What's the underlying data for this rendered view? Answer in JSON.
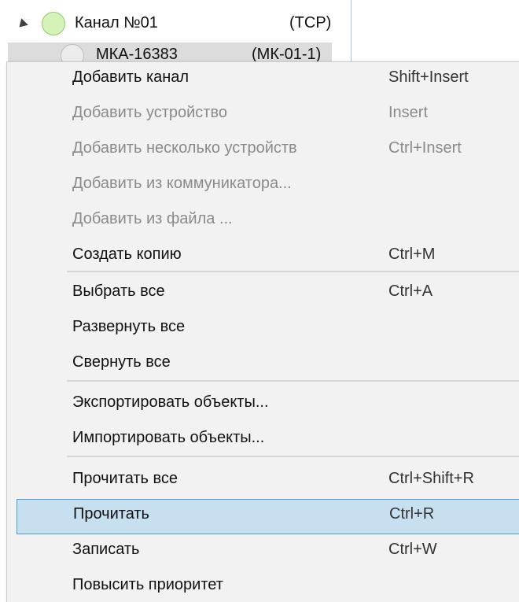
{
  "tree": {
    "channel": {
      "name": "Канал №01",
      "protocol": "(TCP)"
    },
    "device": {
      "name": "МКА-16383",
      "type": "(МК-01-1)"
    }
  },
  "context_menu": {
    "items": [
      {
        "label": "Добавить канал",
        "shortcut": "Shift+Insert",
        "enabled": true
      },
      {
        "label": "Добавить устройство",
        "shortcut": "Insert",
        "enabled": false
      },
      {
        "label": "Добавить несколько устройств",
        "shortcut": "Ctrl+Insert",
        "enabled": false
      },
      {
        "label": "Добавить из коммуникатора...",
        "shortcut": "",
        "enabled": false
      },
      {
        "label": "Добавить из файла ...",
        "shortcut": "",
        "enabled": false
      },
      {
        "label": "Создать копию",
        "shortcut": "Ctrl+M",
        "enabled": true
      },
      {
        "label": "Выбрать все",
        "shortcut": "Ctrl+A",
        "enabled": true
      },
      {
        "label": "Развернуть все",
        "shortcut": "",
        "enabled": true
      },
      {
        "label": "Свернуть все",
        "shortcut": "",
        "enabled": true
      },
      {
        "label": "Экспортировать объекты...",
        "shortcut": "",
        "enabled": true
      },
      {
        "label": "Импортировать объекты...",
        "shortcut": "",
        "enabled": true
      },
      {
        "label": "Прочитать все",
        "shortcut": "Ctrl+Shift+R",
        "enabled": true
      },
      {
        "label": "Прочитать",
        "shortcut": "Ctrl+R",
        "enabled": true,
        "highlighted": true
      },
      {
        "label": "Записать",
        "shortcut": "Ctrl+W",
        "enabled": true
      },
      {
        "label": "Повысить приоритет",
        "shortcut": "",
        "enabled": true
      }
    ]
  },
  "colors": {
    "menu_background": "#f2f2f2",
    "highlight_fill": "#c7e0f0",
    "highlight_border": "#4c9bd6",
    "disabled_text": "#8a8a8a",
    "status_ok": "#d5f3b8"
  }
}
